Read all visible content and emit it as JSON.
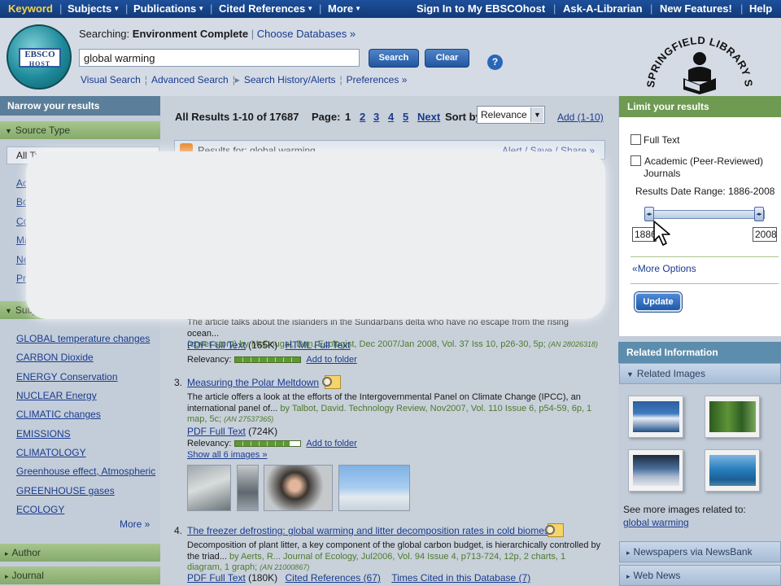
{
  "topnav": {
    "keyword": "Keyword",
    "subjects": "Subjects",
    "publications": "Publications",
    "cited_references": "Cited References",
    "more": "More",
    "sign_in": "Sign In to My EBSCOhost",
    "ask_librarian": "Ask-A-Librarian",
    "new_features": "New Features!",
    "help": "Help"
  },
  "header": {
    "logo_line1": "EBSCO",
    "logo_line2": "HOST",
    "searching_label": "Searching:",
    "database": "Environment Complete",
    "choose_databases": "Choose Databases »",
    "search_value": "global warming",
    "search_button": "Search",
    "clear_button": "Clear",
    "help_icon": "?",
    "visual_search": "Visual Search",
    "advanced_search": "Advanced Search",
    "search_history": "Search History/Alerts",
    "preferences": "Preferences »",
    "library_name": "SPRINGFIELD LIBRARY SYSTEM"
  },
  "left": {
    "narrow_title": "Narrow your results",
    "source_type": "Source Type",
    "all_types": "All Types",
    "source_stubs": [
      "Ac",
      "Bo",
      "Co",
      "Ma",
      "Ne",
      "Pri"
    ],
    "subject_stub": "Subjec",
    "subjects": [
      "GLOBAL temperature changes",
      "CARBON Dioxide",
      "ENERGY Conservation",
      "NUCLEAR Energy",
      "CLIMATIC changes",
      "EMISSIONS",
      "CLIMATOLOGY",
      "Greenhouse effect, Atmospheric",
      "GREENHOUSE gases",
      "ECOLOGY"
    ],
    "more": "More »",
    "author": "Author",
    "journal": "Journal"
  },
  "results": {
    "summary": "All Results 1-10 of 17687",
    "page_label": "Page:",
    "pages": [
      "1",
      "2",
      "3",
      "4",
      "5"
    ],
    "next": "Next",
    "sort_label": "Sort by:",
    "sort_value": "Relevance",
    "add": "Add (1-10)",
    "rss_text": "Results for: global warming",
    "alert_save_share": "Alert / Save / Share »",
    "result2": {
      "abstract": "The article talks about the islanders in the Sundarbans delta who have no escape from the rising ocean...",
      "source": "(cover story) by McDougal, Dan. Ecologist, Dec 2007/Jan 2008, Vol. 37 Iss 10, p26-30, 5p;",
      "an": "(AN 28026318)",
      "pdf": "PDF Full Text",
      "pdf_size": "(165K)",
      "html": "HTML Full Text",
      "relevancy": "Relevancy:",
      "add_folder": "Add to folder"
    },
    "result3": {
      "num": "3.",
      "title": "Measuring the Polar Meltdown",
      "abstract": "The article offers a look at the efforts of the Intergovernmental Panel on Climate Change (IPCC), an international panel of...",
      "source": "by Talbot, David. Technology Review, Nov2007, Vol. 110 Issue 6, p54-59, 6p, 1 map, 5c;",
      "an": "(AN 27537365)",
      "pdf": "PDF Full Text",
      "pdf_size": "(724K)",
      "relevancy": "Relevancy:",
      "add_folder": "Add to folder",
      "show_images": "Show all 6 images »"
    },
    "result4": {
      "num": "4.",
      "title": "The freezer defrosting: global warming and litter decomposition rates in cold biomes",
      "abstract": "Decomposition of plant litter, a key component of the global carbon budget, is hierarchically controlled by the triad...",
      "source": "by Aerts, R... Journal of Ecology, Jul2006, Vol. 94 Issue 4, p713-724, 12p, 2 charts, 1 diagram, 1 graph;",
      "an": "(AN 21000867)",
      "pdf": "PDF Full Text",
      "pdf_size": "(180K)",
      "cited_refs": "Cited References (67)",
      "times_cited": "Times Cited in this Database (7)"
    }
  },
  "right": {
    "limit_title": "Limit your results",
    "full_text": "Full Text",
    "academic_line1": "Academic (Peer-Reviewed)",
    "academic_line2": "Journals",
    "date_range_label": "Results Date Range: 1886-2008",
    "year_min": "1886",
    "year_max": "2008",
    "more_options": "More Options",
    "update": "Update",
    "related_info": "Related Information",
    "related_images": "Related Images",
    "see_more": "See more images related to:",
    "see_more_link": "global warming",
    "newspapers": "Newspapers via NewsBank",
    "web_news": "Web News"
  },
  "colors": {
    "nav": "#1d4f9a",
    "active_nav": "#f7d34a",
    "facet_green": "#86aa6c",
    "limit_header": "#6e9a52",
    "link": "#1a3b8f",
    "source_green": "#4e7a2e"
  }
}
